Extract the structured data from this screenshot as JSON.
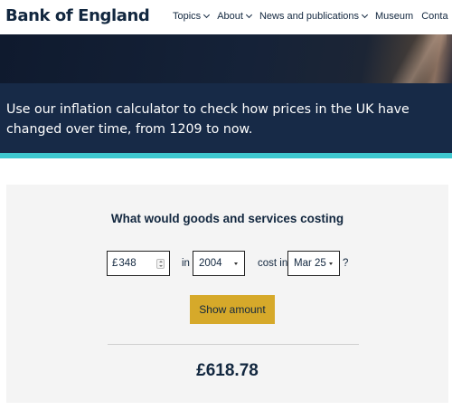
{
  "header": {
    "logo": "Bank of England",
    "nav": [
      {
        "label": "Topics",
        "has_dropdown": true
      },
      {
        "label": "About",
        "has_dropdown": true
      },
      {
        "label": "News and publications",
        "has_dropdown": true
      },
      {
        "label": "Museum",
        "has_dropdown": false
      },
      {
        "label": "Conta",
        "has_dropdown": false
      }
    ]
  },
  "hero": {
    "description": "Use our inflation calculator to check how prices in the UK have changed over time, from 1209 to now."
  },
  "calculator": {
    "title": "What would goods and services costing",
    "currency_symbol": "£",
    "amount": "348",
    "label_in": "in",
    "year": "2004",
    "label_cost_in": "cost in",
    "month": "Mar 25",
    "question_mark": "?",
    "button_label": "Show amount",
    "result": "£618.78"
  },
  "colors": {
    "navy": "#12273f",
    "hero_band": "#172a47",
    "teal_accent": "#3ec8cf",
    "button_gold": "#d6a92a",
    "panel_bg": "#f4f4f4"
  }
}
